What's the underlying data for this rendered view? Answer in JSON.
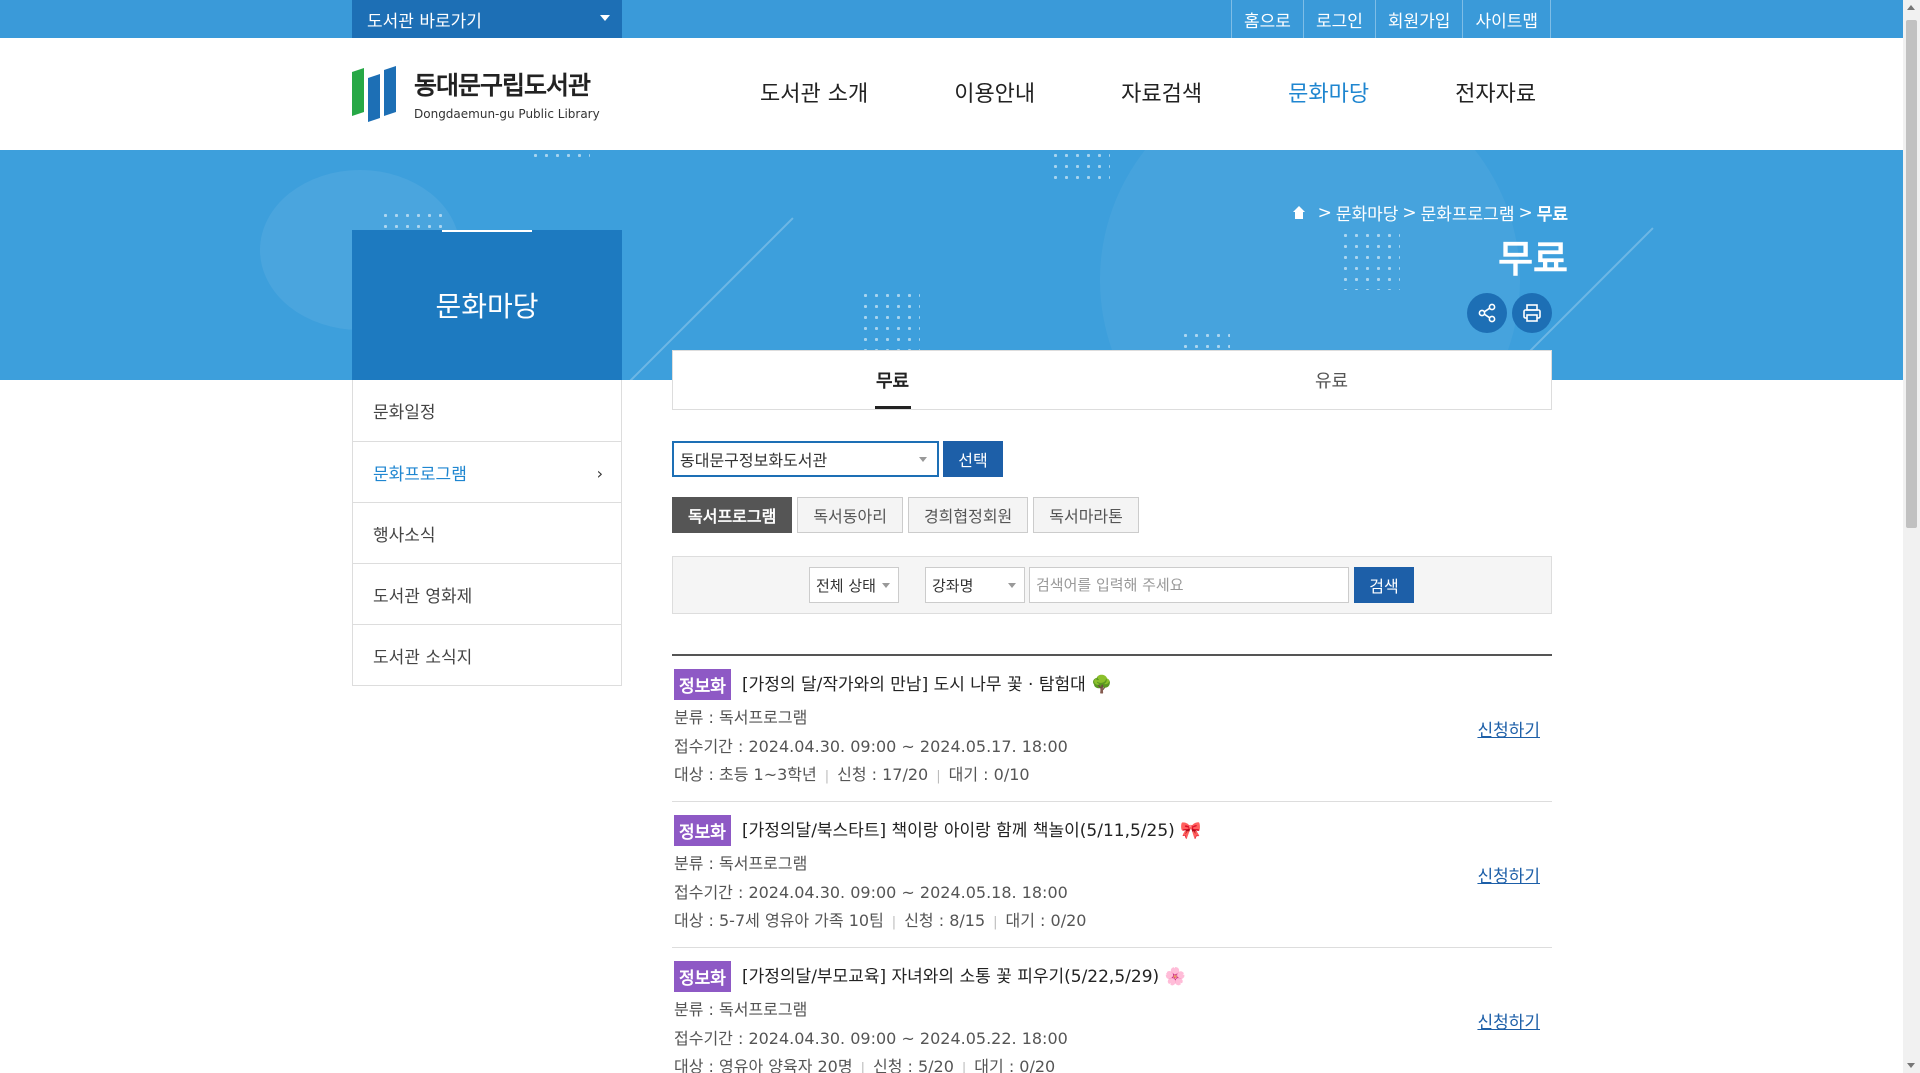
{
  "topbar": {
    "library_shortcut": "도서관 바로가기",
    "links": [
      "홈으로",
      "로그인",
      "회원가입",
      "사이트맵"
    ]
  },
  "header": {
    "logo_ko": "동대문구립도서관",
    "logo_en": "Dongdaemun-gu Public Library",
    "nav": [
      "도서관 소개",
      "이용안내",
      "자료검색",
      "문화마당",
      "전자자료"
    ],
    "nav_active": "문화마당"
  },
  "breadcrumb": {
    "items": [
      "문화마당",
      "문화프로그램",
      "무료"
    ],
    "separator": ">"
  },
  "page_title": "무료",
  "icons": {
    "share": "share-icon",
    "print": "print-icon",
    "home": "home-icon"
  },
  "sidebar": {
    "title": "문화마당",
    "items": [
      {
        "label": "문화일정"
      },
      {
        "label": "문화프로그램",
        "active": true
      },
      {
        "label": "행사소식"
      },
      {
        "label": "도서관 영화제"
      },
      {
        "label": "도서관 소식지"
      }
    ]
  },
  "tabs": [
    {
      "label": "무료",
      "active": true
    },
    {
      "label": "유료"
    }
  ],
  "branch": {
    "selected": "동대문구정보화도서관",
    "button": "선택"
  },
  "category_tabs": [
    {
      "label": "독서프로그램",
      "active": true
    },
    {
      "label": "독서동아리"
    },
    {
      "label": "경희협정회원"
    },
    {
      "label": "독서마라톤"
    }
  ],
  "search": {
    "status_select": "전체 상태",
    "field_select": "강좌명",
    "placeholder": "검색어를 입력해 주세요",
    "button": "검색"
  },
  "programs": [
    {
      "badge": "정보화",
      "title": "[가정의 달/작가와의 만남] 도시 나무 꽃 · 탐험대",
      "emoji": "🌳",
      "category": "분류 : 독서프로그램",
      "period": "접수기간 : 2024.04.30. 09:00 ~ 2024.05.17. 18:00",
      "target": "대상 : 초등 1~3학년",
      "applied": "신청 : 17/20",
      "waiting": "대기 : 0/10",
      "apply": "신청하기"
    },
    {
      "badge": "정보화",
      "title": "[가정의달/북스타트] 책이랑 아이랑 함께 책놀이(5/11,5/25)",
      "emoji": "🎀",
      "category": "분류 : 독서프로그램",
      "period": "접수기간 : 2024.04.30. 09:00 ~ 2024.05.18. 18:00",
      "target": "대상 : 5-7세 영유아 가족 10팀",
      "applied": "신청 : 8/15",
      "waiting": "대기 : 0/20",
      "apply": "신청하기"
    },
    {
      "badge": "정보화",
      "title": "[가정의달/부모교육] 자녀와의 소통 꽃 피우기(5/22,5/29)",
      "emoji": "🌸",
      "category": "분류 : 독서프로그램",
      "period": "접수기간 : 2024.04.30. 09:00 ~ 2024.05.22. 18:00",
      "target": "대상 : 영유아 양육자 20명",
      "applied": "신청 : 5/20",
      "waiting": "대기 : 0/20",
      "apply": "신청하기"
    }
  ]
}
